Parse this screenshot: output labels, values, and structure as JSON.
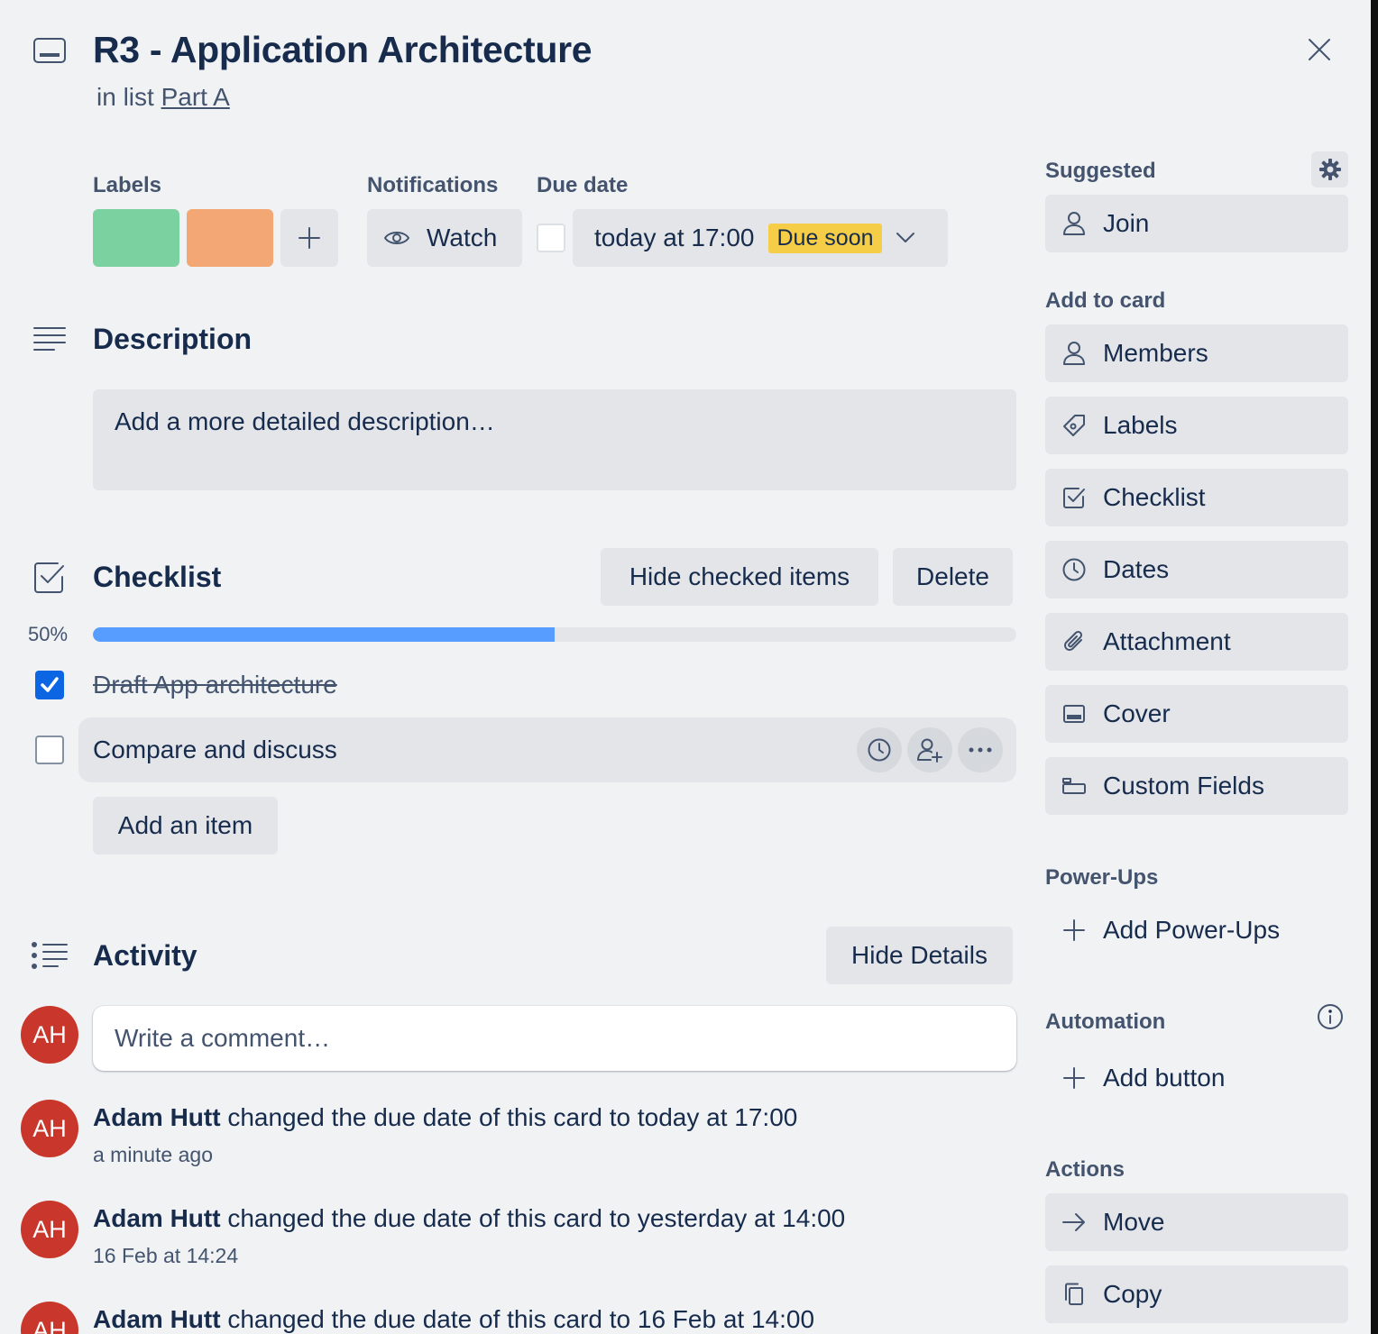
{
  "card": {
    "title": "R3 - Application Architecture",
    "list_prefix": "in list",
    "list_name": "Part A"
  },
  "labels": {
    "heading": "Labels",
    "colors": [
      "#7bd19f",
      "#f3a774"
    ]
  },
  "notifications": {
    "heading": "Notifications",
    "watch_label": "Watch"
  },
  "due": {
    "heading": "Due date",
    "value": "today at 17:00",
    "badge": "Due soon",
    "badge_color": "#f5cd47"
  },
  "description": {
    "heading": "Description",
    "placeholder": "Add a more detailed description…"
  },
  "checklist": {
    "heading": "Checklist",
    "hide_label": "Hide checked items",
    "delete_label": "Delete",
    "percent_text": "50%",
    "progress": 0.5,
    "progress_color": "#579dff",
    "items": [
      {
        "text": "Draft App architecture",
        "checked": true
      },
      {
        "text": "Compare and discuss",
        "checked": false
      }
    ],
    "add_label": "Add an item"
  },
  "activity": {
    "heading": "Activity",
    "toggle_label": "Hide Details",
    "comment_placeholder": "Write a comment…",
    "user_initials": "AH",
    "entries": [
      {
        "initials": "AH",
        "user": "Adam Hutt",
        "text": " changed the due date of this card to today at 17:00",
        "time": "a minute ago"
      },
      {
        "initials": "AH",
        "user": "Adam Hutt",
        "text": " changed the due date of this card to yesterday at 14:00",
        "time": "16 Feb at 14:24"
      },
      {
        "initials": "AH",
        "user": "Adam Hutt",
        "text": " changed the due date of this card to 16 Feb at 14:00",
        "time": ""
      }
    ]
  },
  "sidebar": {
    "suggested_heading": "Suggested",
    "join_label": "Join",
    "add_heading": "Add to card",
    "add_items": [
      {
        "label": "Members",
        "icon": "person-icon"
      },
      {
        "label": "Labels",
        "icon": "tag-icon"
      },
      {
        "label": "Checklist",
        "icon": "checkbox-icon"
      },
      {
        "label": "Dates",
        "icon": "clock-icon"
      },
      {
        "label": "Attachment",
        "icon": "paperclip-icon"
      },
      {
        "label": "Cover",
        "icon": "cover-icon"
      },
      {
        "label": "Custom Fields",
        "icon": "custom-fields-icon"
      }
    ],
    "powerups_heading": "Power-Ups",
    "add_powerups_label": "Add Power-Ups",
    "automation_heading": "Automation",
    "add_button_label": "Add button",
    "actions_heading": "Actions",
    "move_label": "Move",
    "copy_label": "Copy"
  }
}
